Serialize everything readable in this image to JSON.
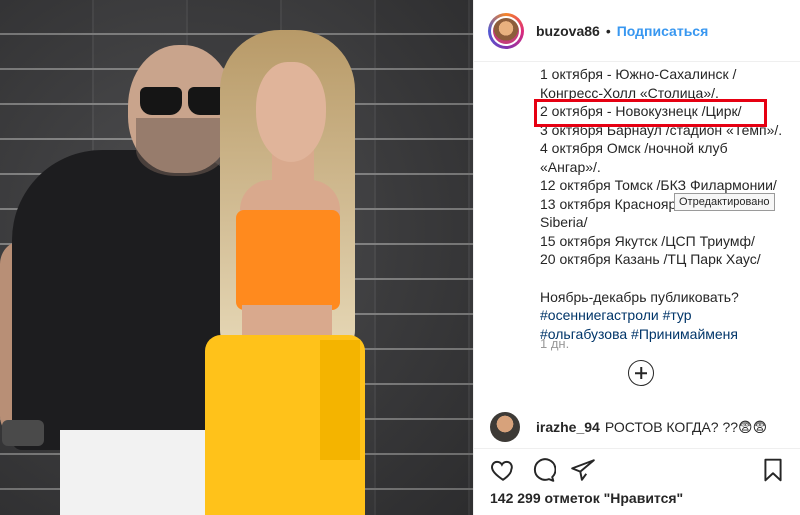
{
  "post": {
    "username": "buzova86",
    "separator": "•",
    "follow_label": "Подписаться"
  },
  "caption": {
    "lines": [
      "1 октября - Южно-Сахалинск /",
      "Конгресс-Холл «Столица»/.",
      "2 октября - Новокузнецк /Цирк/",
      "3 октября Барнаул /стадион «Темп»/.",
      "4 октября Омск /ночной клуб",
      "«Ангар»/.",
      "12 октября Томск /БКЗ Филармонии/",
      "13 октября Красноярск /Grand Hall",
      "Siberia/",
      "15 октября Якутск /ЦСП Триумф/",
      "20 октября Казань /ТЦ Парк Хаус/",
      "",
      "Ноябрь-декабрь публиковать?"
    ],
    "hashtags": [
      "#осенниегастроли",
      "#тур",
      "#ольгабузова",
      "#Принимайменя"
    ]
  },
  "tooltip": "Отредактировано",
  "time_ago": "1 дн.",
  "comment": {
    "user": "irazhe_94",
    "text": "РОСТОВ КОГДА? ??😨😨"
  },
  "icons": {
    "like": "heart-icon",
    "comment": "comment-icon",
    "share": "share-icon",
    "save": "bookmark-icon",
    "more": "plus-circle-icon"
  },
  "likes_text": "142 299 отметок \"Нравится\"",
  "colors": {
    "link": "#3897f0",
    "hashtag": "#003569",
    "highlight": "#e60012",
    "muted": "#999999"
  }
}
